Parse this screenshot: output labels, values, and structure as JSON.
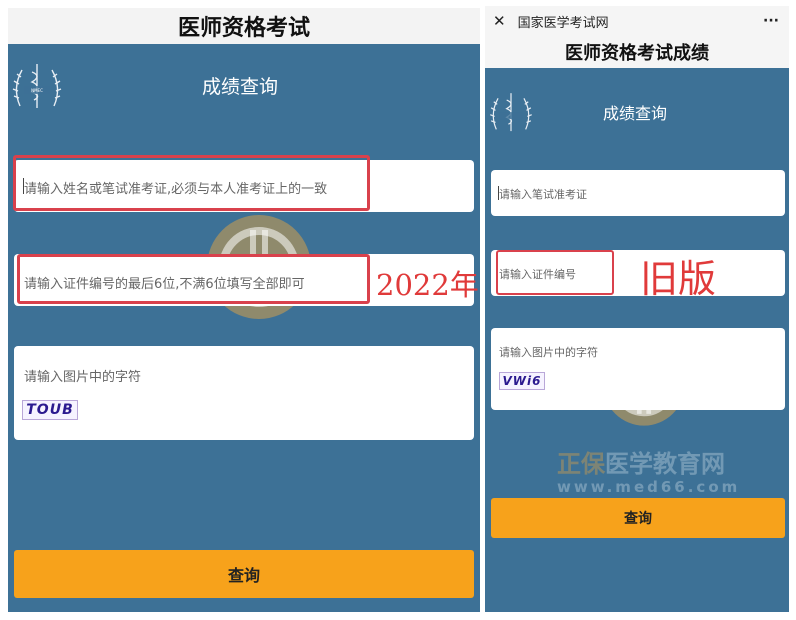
{
  "left": {
    "app_title": "医师资格考试",
    "query_title": "成绩查询",
    "fields": [
      {
        "placeholder": "请输入姓名或笔试准考证,必须与本人准考证上的一致"
      },
      {
        "placeholder": "请输入证件编号的最后6位,不满6位填写全部即可"
      },
      {
        "placeholder": "请输入图片中的字符"
      }
    ],
    "captcha_text": "TOUB",
    "submit_label": "查询",
    "annotation_label": "2022年"
  },
  "right": {
    "window_title": "国家医学考试网",
    "close_icon_glyph": "✕",
    "more_icon_glyph": "···",
    "app_title": "医师资格考试成绩",
    "query_title": "成绩查询",
    "fields": [
      {
        "placeholder": "请输入笔试准考证"
      },
      {
        "placeholder": "请输入证件编号"
      },
      {
        "placeholder": "请输入图片中的字符"
      }
    ],
    "captcha_text": "VWi6",
    "submit_label": "查询",
    "annotation_label": "旧版"
  },
  "watermark": {
    "brand_cn_orange": "正保",
    "brand_cn_blue": "医学教育网",
    "url": "www.med66.com"
  },
  "colors": {
    "panel_blue": "#3d7196",
    "submit_orange": "#f7a21b",
    "annotation_red": "#d9414c"
  }
}
